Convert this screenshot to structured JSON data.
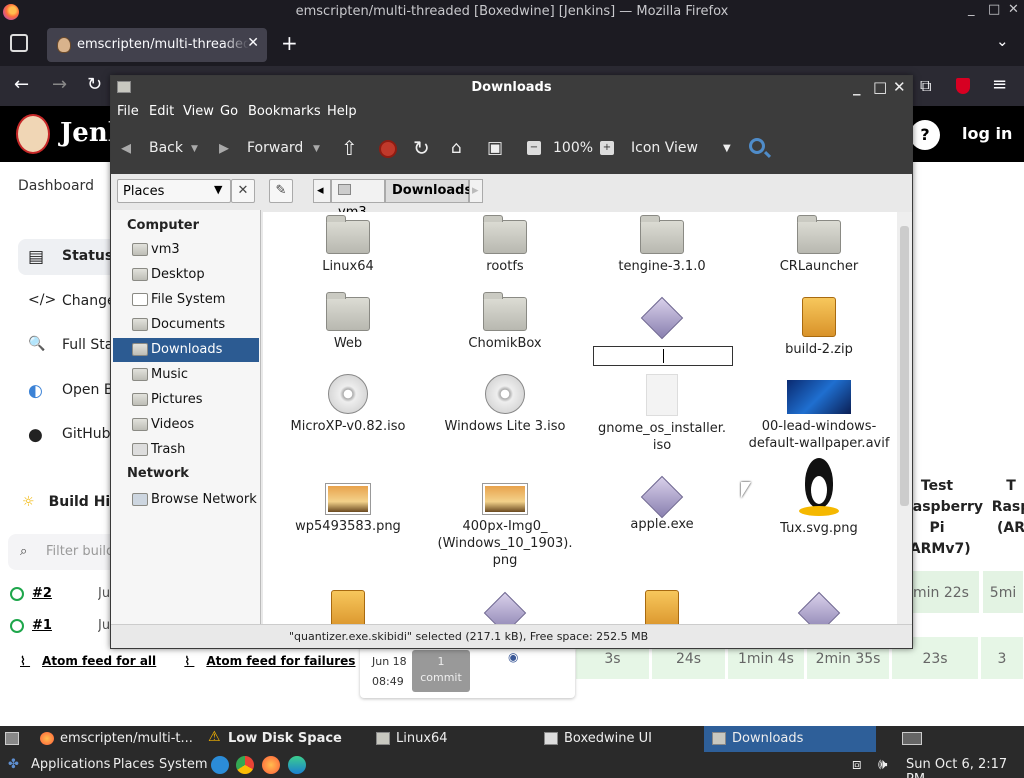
{
  "firefox": {
    "window_title": "emscripten/multi-threaded [Boxedwine] [Jenkins] — Mozilla Firefox",
    "tab_label": "emscripten/multi-threaded [",
    "minimize": "_",
    "maximize": "□",
    "close": "✕",
    "tab_close": "✕",
    "new_tab": "+",
    "list_tabs": "⌄"
  },
  "jenkins": {
    "title": "Jenk",
    "login": "log in",
    "help": "?",
    "breadcrumb": "Dashboard",
    "sidebar": [
      {
        "label": "Status",
        "icon": "▤"
      },
      {
        "label": "Change",
        "icon": "</>"
      },
      {
        "label": "Full Sta",
        "icon": "🔍"
      },
      {
        "label": "Open Bl",
        "icon": "◐"
      },
      {
        "label": "GitHub",
        "icon": "●"
      }
    ],
    "build_history": "Build Hi",
    "filter_placeholder": "Filter build",
    "runs": [
      {
        "num": "#2",
        "date": "Ju"
      },
      {
        "num": "#1",
        "date": "Ju"
      }
    ],
    "feed_all": "Atom feed for all",
    "feed_failures": "Atom feed for failures",
    "stage_headers": [
      {
        "text": "Test Raspberry Pi (ARMv7)"
      },
      {
        "text": "T Rasp (AR"
      }
    ],
    "stage_durations_row1": [
      "min 22s",
      "5mi"
    ],
    "commit": {
      "date": "Jun 18",
      "time": "08:49",
      "count": "1",
      "unit": "commit"
    },
    "stage_durations_row2": [
      "3s",
      "24s",
      "1min 4s",
      "2min 35s",
      "23s",
      "3"
    ]
  },
  "nautilus": {
    "title": "Downloads",
    "menu": [
      "File",
      "Edit",
      "View",
      "Go",
      "Bookmarks",
      "Help"
    ],
    "toolbar": {
      "back": "Back",
      "forward": "Forward",
      "zoom": "100%",
      "view_mode": "Icon View"
    },
    "places_select": "Places",
    "path": [
      "vm3",
      "Downloads"
    ],
    "sidebar_sections": [
      {
        "heading": "Computer",
        "items": [
          "vm3",
          "Desktop",
          "File System",
          "Documents",
          "Downloads",
          "Music",
          "Pictures",
          "Videos",
          "Trash"
        ]
      },
      {
        "heading": "Network",
        "items": [
          "Browse Network"
        ]
      }
    ],
    "selected_place": "Downloads",
    "files": [
      {
        "name": "Linux64",
        "kind": "folder-icon"
      },
      {
        "name": "rootfs",
        "kind": "folder-icon"
      },
      {
        "name": "tengine-3.1.0",
        "kind": "folder-icon"
      },
      {
        "name": "CRLauncher",
        "kind": "folder-icon"
      },
      {
        "name": "Web",
        "kind": "folder-icon"
      },
      {
        "name": "ChomikBox",
        "kind": "folder-icon"
      },
      {
        "name": "",
        "kind": "executable-icon"
      },
      {
        "name": "build-2.zip",
        "kind": "archive-icon"
      },
      {
        "name": "MicroXP-v0.82.iso",
        "kind": "disc-icon"
      },
      {
        "name": "Windows Lite 3.iso",
        "kind": "disc-icon"
      },
      {
        "name": "gnome_os_installer.\niso",
        "kind": "blank-file-icon"
      },
      {
        "name": "00-lead-windows-\ndefault-wallpaper.avif",
        "kind": "wallpaper-thumbnail"
      },
      {
        "name": "wp5493583.png",
        "kind": "image-icon"
      },
      {
        "name": "400px-Img0_\n(Windows_10_1903).\npng",
        "kind": "image-icon"
      },
      {
        "name": "apple.exe",
        "kind": "executable-icon"
      },
      {
        "name": "Tux.svg.png",
        "kind": "tux-icon"
      }
    ],
    "status": "\"quantizer.exe.skibidi\" selected (217.1 kB), Free space: 252.5 MB"
  },
  "taskbar": [
    {
      "label": "emscripten/multi-t...",
      "active": false
    },
    {
      "label": "Low Disk Space",
      "active": false
    },
    {
      "label": "Linux64",
      "active": false
    },
    {
      "label": "Boxedwine UI",
      "active": false
    },
    {
      "label": "Downloads",
      "active": true
    }
  ],
  "panel": {
    "menus": [
      "Applications",
      "Places",
      "System"
    ],
    "clock": "Sun Oct  6,  2:17 PM"
  }
}
